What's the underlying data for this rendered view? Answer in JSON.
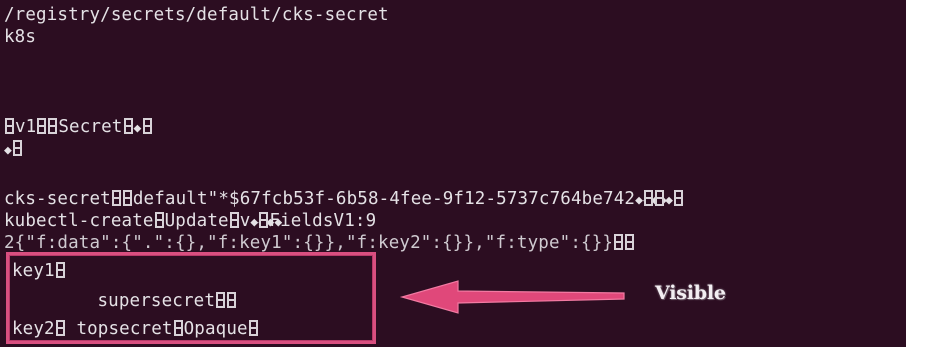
{
  "terminal": {
    "line1": "/registry/secrets/default/cks-secret",
    "line2": "k8s",
    "line3_a": "v1",
    "line3_b": "Secret",
    "line6_a": "cks-secret",
    "line6_b": "default\"*$67fcb53f-6b58-4fee-9f12-5737c764be742",
    "line7_a": "kubectl-create",
    "line7_b": "Update",
    "line7_c": "v",
    "line7_d": "FieldsV1:9",
    "line8_a": "2{\"f:data\":{\".\":{},\"f:key1\":{}",
    "line8_b": "},\"f:key2\":{}},\"f:type\":{}}",
    "line9_a": "key1",
    "line10_a": "supersecret",
    "line11_a": "key2",
    "line11_b": "topsecret",
    "line11_c": "Opaque"
  },
  "annotation": {
    "label": "Visible",
    "highlight_color": "#d94f80",
    "arrow_color": "#e0487a"
  },
  "colors": {
    "terminal_bg": "#2c0d21",
    "terminal_text": "#e4e1e5"
  }
}
